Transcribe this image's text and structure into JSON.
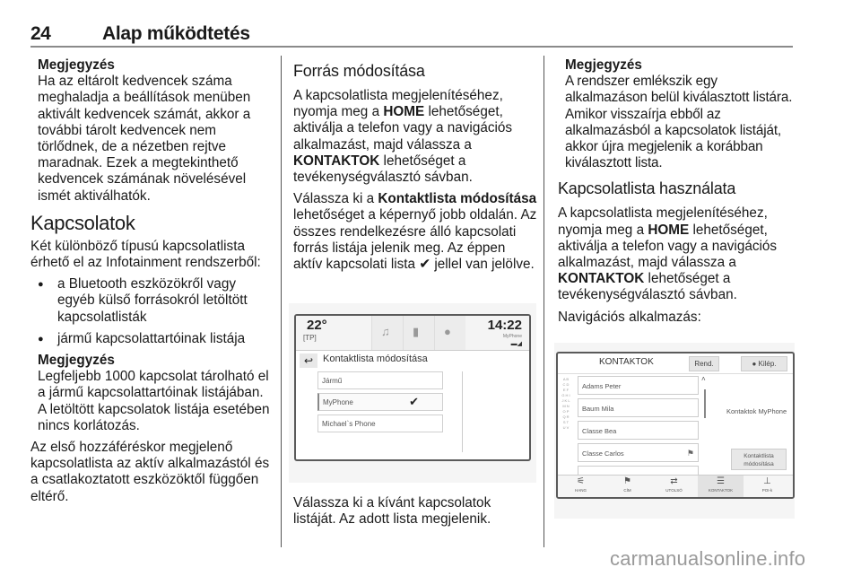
{
  "header": {
    "page_number": "24",
    "title": "Alap működtetés"
  },
  "col1": {
    "note1": {
      "heading": "Megjegyzés",
      "text": "Ha az eltárolt kedvencek száma meghaladja a beállítások menüben aktivált kedvencek számát, akkor a további tárolt kedvencek nem törlődnek, de a nézetben rejtve maradnak. Ezek a megtekinthető kedvencek számának növelésével ismét aktiválhatók."
    },
    "section_title": "Kapcsolatok",
    "intro": "Két különböző típusú kapcsolatlista érhető el az Infotainment rendszerből:",
    "bullets": [
      "a Bluetooth eszközökről vagy egyéb külső forrásokról letöltött kapcsolatlisták",
      "jármű kapcsolattartóinak listája"
    ],
    "note2": {
      "heading": "Megjegyzés",
      "text": "Legfeljebb 1000 kapcsolat tárolható el a jármű kapcsolattartóinak listájában. A letöltött kapcsolatok listája esetében nincs korlátozás."
    },
    "closing": "Az első hozzáféréskor megjelenő kapcsolatlista az aktív alkalmazástól és a csatlakoztatott eszközöktől függően eltérő."
  },
  "col2": {
    "section_title": "Forrás módosítása",
    "p1": {
      "a": "A kapcsolatlista megjelenítéséhez, nyomja meg a ",
      "b1": "HOME",
      "c": " lehetőséget, aktiválja a telefon vagy a navigációs alkalmazást, majd válassza a ",
      "b2": "KONTAKTOK",
      "d": " lehetőséget a tevékenységválasztó sávban."
    },
    "p2": {
      "a": "Válassza ki a ",
      "b1": "Kontaktlista módosítása",
      "c": " lehetőséget a képernyő jobb oldalán. Az összes rendelkezésre álló kapcsolati forrás listája jelenik meg. Az éppen aktív kapcsolati lista ",
      "check": "✔",
      "d": " jellel van jelölve."
    },
    "screen": {
      "temperature": "22°",
      "tp": "[TP]",
      "time": "14:22",
      "device": "MyPhone",
      "title": "Kontaktlista módosítása",
      "sources": [
        {
          "label": "Jármű",
          "selected": false
        },
        {
          "label": "MyPhone",
          "selected": true
        },
        {
          "label": "Michael`s Phone",
          "selected": false
        }
      ],
      "check_glyph": "✔"
    },
    "p3": "Válassza ki a kívánt kapcsolatok listáját. Az adott lista megjelenik."
  },
  "col3": {
    "note": {
      "heading": "Megjegyzés",
      "text": "A rendszer emlékszik egy alkalmazáson belül kiválasztott listára. Amikor visszaírja ebből az alkalmazásból a kapcsolatok listáját, akkor újra megjelenik a korábban kiválasztott lista."
    },
    "section_title": "Kapcsolatlista használata",
    "p1": {
      "a": "A kapcsolatlista megjelenítéséhez, nyomja meg a ",
      "b1": "HOME",
      "c": " lehetőséget, aktiválja a telefon vagy a navigációs alkalmazást, majd válassza a ",
      "b2": "KONTAKTOK",
      "d": " lehetőséget a tevékenységválasztó sávban."
    },
    "p2": "Navigációs alkalmazás:",
    "screen": {
      "title": "KONTAKTOK",
      "sort_button": "Rend.",
      "exit_button": "Kilép.",
      "contacts": [
        "Adams Peter",
        "Baum Mila",
        "Classe Bea",
        "Classe Carlos"
      ],
      "info": "Kontaktok MyPhone",
      "edit_button_line1": "Kontaktlista",
      "edit_button_line2": "módosítása",
      "nav": [
        {
          "label": "HANG",
          "icon": "voice-icon"
        },
        {
          "label": "CÍM",
          "icon": "flag-icon"
        },
        {
          "label": "UTOLSÓ",
          "icon": "recent-icon"
        },
        {
          "label": "KONTAKTOK",
          "icon": "contacts-icon",
          "active": true
        },
        {
          "label": "POI-k",
          "icon": "poi-icon"
        }
      ]
    }
  },
  "watermark": "carmanualsonline.info"
}
